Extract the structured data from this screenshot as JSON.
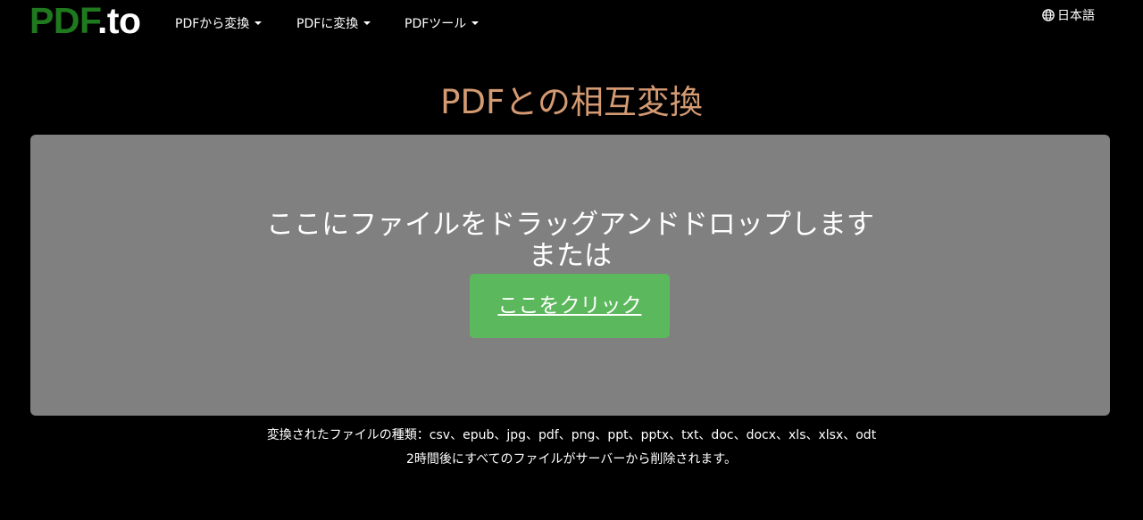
{
  "header": {
    "logo_pdf": "PDF",
    "logo_to": ".to",
    "nav": [
      {
        "label": "PDFから変換"
      },
      {
        "label": "PDFに変換"
      },
      {
        "label": "PDFツール"
      }
    ],
    "language": "日本語"
  },
  "main": {
    "title": "PDFとの相互変換",
    "dropzone": {
      "line1": "ここにファイルをドラッグアンドドロップします",
      "line2": "または",
      "button_label": "ここをクリック"
    },
    "info_formats": "変換されたファイルの種類：csv、epub、jpg、pdf、png、ppt、pptx、txt、doc、docx、xls、xlsx、odt",
    "info_deletion": "2時間後にすべてのファイルがサーバーから削除されます。"
  },
  "colors": {
    "background": "#000000",
    "logo_green": "#1f7a1f",
    "title": "#d49a72",
    "dropzone": "#808080",
    "button": "#5cb85c"
  },
  "icons": {
    "language": "globe-icon",
    "dropdown": "caret-down-icon"
  }
}
